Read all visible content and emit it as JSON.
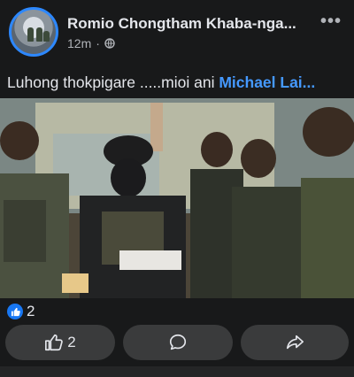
{
  "post": {
    "author": "Romio Chongtham Khaba-nga...",
    "time": "12m",
    "separator": "·",
    "caption_text": "Luhong thokpigare .....mioi ani ",
    "caption_mention": "Michael Lai...",
    "more_label": "•••"
  },
  "reactions": {
    "count": "2"
  },
  "actions": {
    "like_count": "2"
  },
  "colors": {
    "accent": "#1877f2",
    "mention": "#4599ff",
    "background": "#18191a",
    "button": "#3a3b3c"
  },
  "icons": [
    "globe-icon",
    "more-icon",
    "like-icon",
    "comment-icon",
    "share-icon"
  ]
}
